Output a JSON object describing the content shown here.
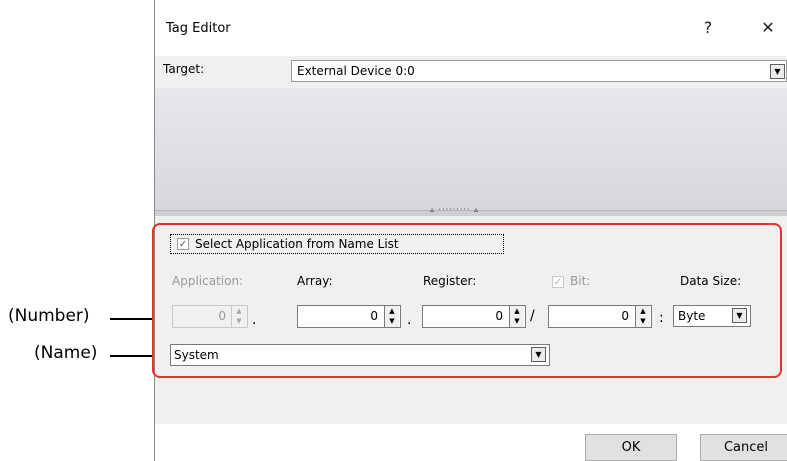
{
  "window": {
    "title": "Tag Editor",
    "help_glyph": "?",
    "close_glyph": "✕"
  },
  "target": {
    "label": "Target:",
    "value": "External Device 0:0"
  },
  "splitter": {
    "grip": "▵ ········· ▵"
  },
  "options": {
    "select_from_name_list_label": "Select Application from Name List",
    "select_from_name_list_checked": true
  },
  "fields": {
    "application": {
      "label": "Application:",
      "value": "0",
      "enabled": false
    },
    "array": {
      "label": "Array:",
      "value": "0"
    },
    "register": {
      "label": "Register:",
      "value": "0"
    },
    "bit": {
      "label": "Bit:",
      "value": "0",
      "checked": true,
      "enabled": false
    },
    "data_size": {
      "label": "Data Size:",
      "value": "Byte"
    },
    "separators": {
      "dot1": ".",
      "dot2": ".",
      "slash": "/",
      "colon": ":"
    }
  },
  "name_combo": {
    "value": "System"
  },
  "buttons": {
    "ok": "OK",
    "cancel": "Cancel"
  },
  "annotations": {
    "number": "(Number)",
    "name": "(Name)"
  },
  "colors": {
    "highlight_border": "#e8312f",
    "dialog_bg": "#f0f0f0"
  }
}
